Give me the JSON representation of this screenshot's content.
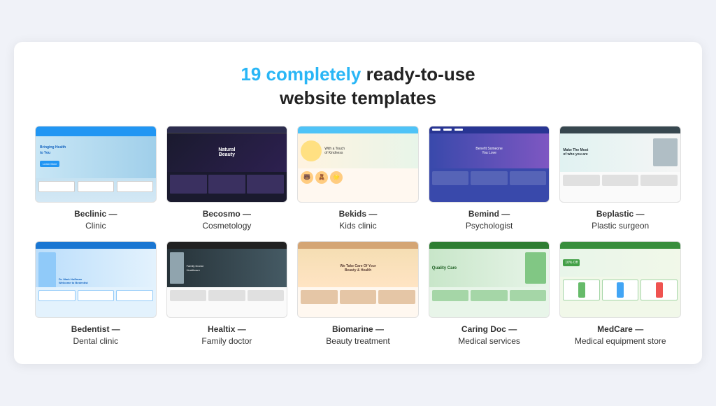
{
  "headline": {
    "part1": "19 completely",
    "part2": "ready-to-use",
    "part3": "website templates"
  },
  "templates": [
    {
      "id": "beclinic",
      "name": "Beclinic —",
      "type": "Clinic",
      "row": 1
    },
    {
      "id": "becosmo",
      "name": "Becosmo —",
      "type": "Cosmetology",
      "row": 1
    },
    {
      "id": "bekids",
      "name": "Bekids —",
      "type": "Kids clinic",
      "row": 1
    },
    {
      "id": "bemind",
      "name": "Bemind —",
      "type": "Psychologist",
      "row": 1
    },
    {
      "id": "beplastic",
      "name": "Beplastic —",
      "type": "Plastic surgeon",
      "row": 1
    },
    {
      "id": "bedentist",
      "name": "Bedentist —",
      "type": "Dental clinic",
      "row": 2
    },
    {
      "id": "healtix",
      "name": "Healtix —",
      "type": "Family doctor",
      "row": 2
    },
    {
      "id": "biomarine",
      "name": "Biomarine —",
      "type": "Beauty treatment",
      "row": 2
    },
    {
      "id": "caringdoc",
      "name": "Caring Doc —",
      "type": "Medical services",
      "row": 2
    },
    {
      "id": "medcare",
      "name": "MedCare —",
      "type": "Medical equipment store",
      "row": 2
    }
  ]
}
